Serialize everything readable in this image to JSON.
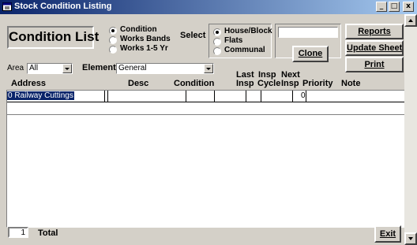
{
  "window": {
    "title": "Stock Condition Listing",
    "controls": {
      "minimize": "_",
      "restore": "□",
      "close": "x"
    }
  },
  "form": {
    "heading": "Condition List",
    "list_type_options": [
      {
        "label": "Condition",
        "selected": true
      },
      {
        "label": "Works Bands",
        "selected": false
      },
      {
        "label": "Works 1-5 Yr",
        "selected": false
      }
    ],
    "select_label": "Select",
    "select_options": [
      {
        "label": "House/Block",
        "selected": true
      },
      {
        "label": "Flats",
        "selected": false
      },
      {
        "label": "Communal",
        "selected": false
      }
    ],
    "clone_input_value": "",
    "buttons": {
      "reports": "Reports",
      "update_sheet": "Update Sheet",
      "print": "Print",
      "clone": "Clone",
      "exit": "Exit"
    },
    "area_label": "Area",
    "area_value": "All",
    "element_label": "Element",
    "element_value": "General"
  },
  "columns": {
    "address": "Address",
    "desc": "Desc",
    "condition": "Condition",
    "last_insp_1": "Last",
    "last_insp_2": "Insp",
    "insp_cycle_1": "Insp",
    "insp_cycle_2": "Cycle",
    "next_insp_1": "Next",
    "next_insp_2": "Insp",
    "priority": "Priority",
    "note": "Note"
  },
  "rows": [
    {
      "address": "0 Railway Cuttings",
      "desc": "",
      "condition": "",
      "last_insp": "",
      "insp_cycle": "",
      "next_insp": "",
      "priority": "0",
      "note": ""
    }
  ],
  "footer": {
    "count": "1",
    "total_label": "Total"
  },
  "colors": {
    "title_bar_start": "#0a246a",
    "title_bar_end": "#a6caf0",
    "selection": "#0a246a",
    "face": "#d4d0c8"
  }
}
